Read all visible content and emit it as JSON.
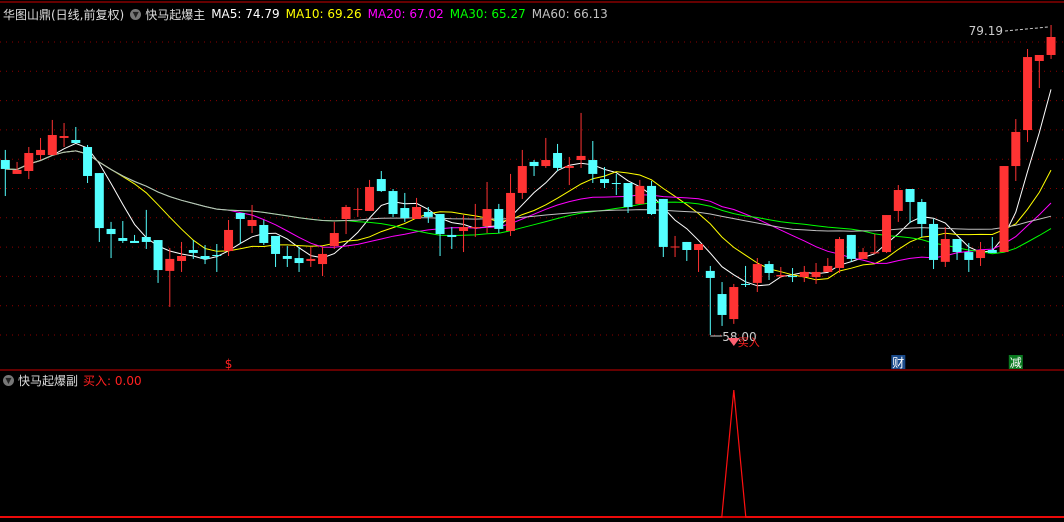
{
  "header": {
    "title": "华图山鼎(日线,前复权)",
    "indicator": "快马起爆主",
    "ma": [
      {
        "label": "MA5: 74.79",
        "color": "#ffffff",
        "period": 5
      },
      {
        "label": "MA10: 69.26",
        "color": "#ffff00",
        "period": 10
      },
      {
        "label": "MA20: 67.02",
        "color": "#ff00ff",
        "period": 20
      },
      {
        "label": "MA30: 65.27",
        "color": "#00ff00",
        "period": 30
      },
      {
        "label": "MA60: 66.13",
        "color": "#c0c0c0",
        "period": 60
      }
    ]
  },
  "sub": {
    "indicator": "快马起爆副",
    "buy_label": "买入: 0.00"
  },
  "annotations": {
    "high_label": "79.19",
    "low_label": "58.00",
    "buy_text": "买入",
    "dollar": "$",
    "cai": "财",
    "jian": "减"
  },
  "colors": {
    "up": "#ff3333",
    "down": "#54ffff",
    "grid": "#8b0000",
    "axis": "#cc0000",
    "cai_bg": "#1a4a8a",
    "jian_bg": "#0a7a20"
  },
  "chart_data": {
    "type": "candlestick",
    "ylim": [
      58.0,
      79.19
    ],
    "ohlc": [
      [
        69.96,
        70.65,
        67.5,
        69.35
      ],
      [
        69.01,
        69.83,
        69.01,
        69.28
      ],
      [
        69.21,
        70.85,
        68.66,
        70.44
      ],
      [
        70.3,
        71.47,
        69.96,
        70.65
      ],
      [
        70.3,
        72.7,
        70.3,
        71.67
      ],
      [
        71.47,
        72.49,
        70.85,
        71.6
      ],
      [
        71.33,
        72.22,
        71.12,
        71.12
      ],
      [
        70.85,
        70.99,
        68.39,
        68.87
      ],
      [
        69.07,
        69.07,
        64.36,
        65.31
      ],
      [
        65.25,
        65.73,
        63.26,
        64.9
      ],
      [
        64.63,
        65.79,
        64.29,
        64.43
      ],
      [
        64.43,
        64.84,
        64.29,
        64.29
      ],
      [
        64.7,
        66.55,
        63.88,
        64.36
      ],
      [
        64.49,
        64.49,
        61.56,
        62.44
      ],
      [
        62.38,
        63.95,
        59.92,
        63.2
      ],
      [
        63.06,
        64.36,
        62.31,
        63.4
      ],
      [
        63.81,
        64.49,
        63.2,
        63.61
      ],
      [
        63.4,
        64.15,
        62.85,
        63.2
      ],
      [
        63.47,
        64.22,
        62.31,
        63.4
      ],
      [
        63.74,
        65.86,
        63.4,
        65.18
      ],
      [
        66.34,
        66.34,
        64.22,
        65.93
      ],
      [
        65.45,
        66.89,
        64.97,
        65.86
      ],
      [
        65.52,
        65.86,
        64.15,
        64.29
      ],
      [
        64.77,
        64.77,
        62.65,
        63.54
      ],
      [
        63.4,
        64.08,
        62.65,
        63.2
      ],
      [
        63.26,
        64.02,
        62.31,
        62.92
      ],
      [
        63.06,
        64.02,
        62.65,
        63.2
      ],
      [
        62.85,
        64.02,
        62.03,
        63.54
      ],
      [
        64.08,
        65.73,
        63.88,
        64.97
      ],
      [
        65.93,
        66.89,
        64.9,
        66.75
      ],
      [
        66.55,
        68.05,
        66.07,
        66.61
      ],
      [
        66.48,
        68.6,
        66.48,
        68.12
      ],
      [
        68.66,
        69.21,
        67.78,
        67.84
      ],
      [
        67.84,
        67.98,
        66.07,
        66.27
      ],
      [
        66.68,
        67.71,
        65.73,
        66.0
      ],
      [
        65.93,
        67.37,
        65.93,
        66.75
      ],
      [
        66.41,
        66.75,
        65.66,
        66.07
      ],
      [
        66.27,
        66.27,
        63.4,
        64.9
      ],
      [
        64.84,
        65.38,
        63.88,
        64.7
      ],
      [
        65.11,
        66.2,
        63.67,
        65.38
      ],
      [
        65.31,
        66.96,
        64.7,
        65.38
      ],
      [
        65.45,
        68.46,
        64.97,
        66.61
      ],
      [
        66.61,
        66.96,
        64.97,
        65.25
      ],
      [
        65.11,
        69.01,
        64.77,
        67.71
      ],
      [
        67.71,
        70.65,
        67.3,
        69.55
      ],
      [
        69.83,
        69.96,
        68.87,
        69.55
      ],
      [
        69.55,
        71.47,
        69.42,
        69.96
      ],
      [
        70.44,
        71.06,
        69.21,
        69.42
      ],
      [
        69.42,
        70.17,
        68.25,
        69.55
      ],
      [
        69.96,
        73.18,
        69.42,
        70.24
      ],
      [
        69.96,
        71.26,
        68.39,
        69.01
      ],
      [
        68.66,
        69.48,
        68.05,
        68.39
      ],
      [
        68.39,
        69.01,
        67.57,
        68.32
      ],
      [
        68.39,
        68.39,
        66.34,
        66.75
      ],
      [
        66.96,
        68.6,
        66.96,
        68.19
      ],
      [
        68.19,
        68.53,
        66.2,
        66.27
      ],
      [
        67.3,
        67.3,
        63.33,
        64.02
      ],
      [
        64.02,
        64.77,
        63.33,
        64.05
      ],
      [
        64.36,
        64.36,
        63.06,
        63.81
      ],
      [
        63.81,
        64.22,
        62.31,
        64.22
      ],
      [
        62.38,
        62.72,
        58.0,
        61.9
      ],
      [
        60.8,
        61.62,
        58.62,
        59.37
      ],
      [
        59.09,
        61.49,
        58.76,
        61.28
      ],
      [
        61.49,
        62.72,
        61.28,
        61.42
      ],
      [
        61.56,
        63.26,
        60.94,
        62.85
      ],
      [
        62.85,
        63.06,
        61.76,
        62.24
      ],
      [
        62.0,
        62.65,
        61.9,
        62.1
      ],
      [
        62.03,
        62.58,
        61.62,
        61.96
      ],
      [
        61.96,
        62.72,
        61.62,
        62.31
      ],
      [
        61.96,
        62.92,
        61.49,
        62.31
      ],
      [
        62.31,
        63.26,
        62.31,
        62.72
      ],
      [
        62.58,
        64.7,
        62.24,
        64.56
      ],
      [
        64.84,
        64.84,
        63.0,
        63.2
      ],
      [
        63.2,
        63.95,
        63.2,
        63.67
      ],
      [
        63.61,
        64.9,
        63.54,
        63.65
      ],
      [
        63.67,
        66.2,
        63.61,
        66.2
      ],
      [
        66.48,
        68.25,
        65.73,
        67.91
      ],
      [
        67.98,
        67.98,
        65.66,
        67.09
      ],
      [
        67.09,
        67.3,
        64.7,
        65.59
      ],
      [
        65.59,
        65.93,
        62.51,
        63.13
      ],
      [
        63.0,
        65.38,
        62.65,
        64.56
      ],
      [
        64.56,
        64.56,
        63.13,
        63.67
      ],
      [
        63.67,
        64.29,
        62.31,
        63.13
      ],
      [
        63.26,
        64.36,
        62.72,
        63.81
      ],
      [
        63.81,
        64.7,
        63.61,
        63.61
      ],
      [
        63.67,
        69.55,
        63.67,
        69.55
      ],
      [
        69.55,
        72.76,
        68.53,
        71.88
      ],
      [
        72.01,
        77.55,
        71.19,
        77.0
      ],
      [
        76.73,
        77.14,
        74.88,
        77.14
      ],
      [
        77.14,
        79.19,
        76.87,
        78.37
      ]
    ],
    "buy_signal_index": 62,
    "dollar_index": 19,
    "cai_index": 76,
    "jian_index": 86
  }
}
